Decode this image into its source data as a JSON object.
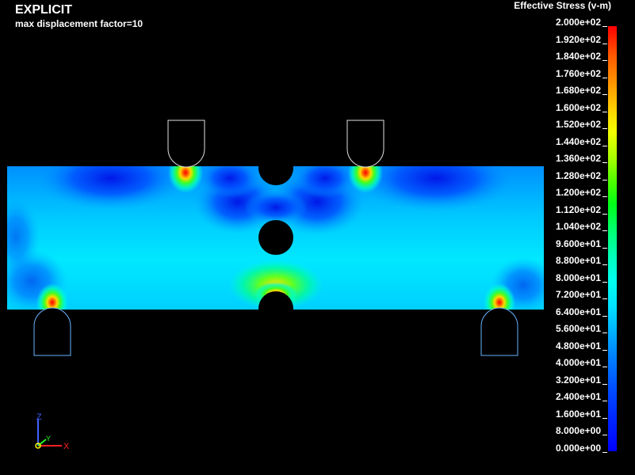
{
  "header": {
    "title": "EXPLICIT",
    "subtitle": "max displacement factor=10"
  },
  "legend": {
    "title": "Effective Stress (v-m)",
    "ticks": [
      "2.000e+02",
      "1.920e+02",
      "1.840e+02",
      "1.760e+02",
      "1.680e+02",
      "1.600e+02",
      "1.520e+02",
      "1.440e+02",
      "1.360e+02",
      "1.280e+02",
      "1.200e+02",
      "1.120e+02",
      "1.040e+02",
      "9.600e+01",
      "8.800e+01",
      "8.000e+01",
      "7.200e+01",
      "6.400e+01",
      "5.600e+01",
      "4.800e+01",
      "4.000e+01",
      "3.200e+01",
      "2.400e+01",
      "1.600e+01",
      "8.000e+00",
      "0.000e+00"
    ],
    "colors": {
      "max": "#ff0000",
      "mid": "#00ff30",
      "min": "#0000ff"
    }
  },
  "triad": {
    "x_label": "X",
    "y_label": "Y",
    "z_label": "Z",
    "x_color": "#ff2020",
    "y_color": "#20ff20",
    "z_color": "#4060ff"
  },
  "model": {
    "field_base_color": "#00d8ff",
    "low_stress_color": "#0030ff",
    "peak_color": "#ff0000",
    "support_outline_color": "#66b3ff",
    "loader_outline_color": "#e0e0e0"
  }
}
